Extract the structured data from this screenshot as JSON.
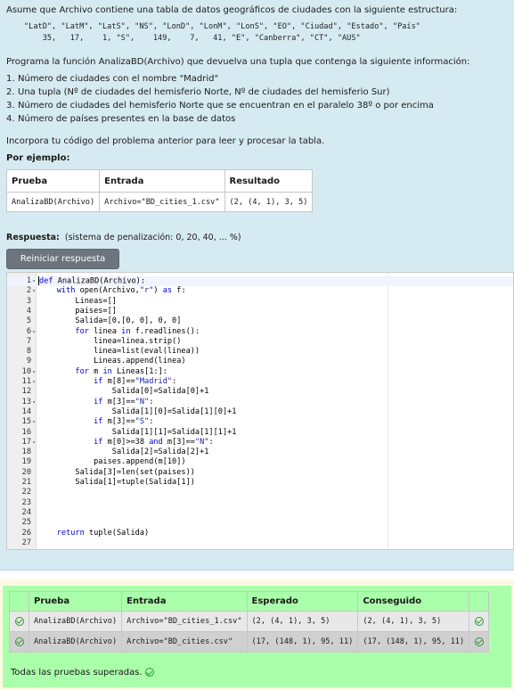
{
  "question": {
    "intro": "Asume que Archivo contiene una tabla de datos geográficos de ciudades con la siguiente estructura:",
    "structure_header": "\"LatD\", \"LatM\", \"LatS\", \"NS\", \"LonD\", \"LonM\", \"LonS\", \"EO\", \"Ciudad\", \"Estado\", \"País\"",
    "structure_row": "    35,   17,    1, \"S\",    149,    7,   41, \"E\", \"Canberra\", \"CT\", \"AUS\"",
    "prompt": "Programa la función AnalizaBD(Archivo) que devuelva una tupla que contenga la siguiente información:",
    "requirements": [
      {
        "num": "1.",
        "text": "Número de ciudades con el nombre \"Madrid\""
      },
      {
        "num": "2.",
        "text": "Una tupla (Nº de ciudades del hemisferio Norte, Nº de ciudades del hemisferio Sur)"
      },
      {
        "num": "3.",
        "text": "Número de ciudades del hemisferio Norte que se encuentran en el paralelo 38º o por encima"
      },
      {
        "num": "4.",
        "text": "Número de países presentes en la base de datos"
      }
    ],
    "incorporate": "Incorpora tu código del problema anterior para leer y procesar la tabla.",
    "example_label": "Por ejemplo:",
    "example_table": {
      "headers": [
        "Prueba",
        "Entrada",
        "Resultado"
      ],
      "rows": [
        [
          "AnalizaBD(Archivo)",
          "Archivo=\"BD_cities_1.csv\"",
          "(2, (4, 1), 3, 5)"
        ]
      ]
    }
  },
  "answer": {
    "label": "Respuesta:",
    "penalty": "(sistema de penalización: 0, 20, 40, ... %)",
    "reset_button": "Reiniciar respuesta"
  },
  "editor": {
    "lines": [
      {
        "n": "1",
        "fold": true,
        "code": "def AnalizaBD(Archivo):"
      },
      {
        "n": "2",
        "fold": true,
        "code": "    with open(Archivo,\"r\") as f:"
      },
      {
        "n": "3",
        "fold": false,
        "code": "        Lineas=[]"
      },
      {
        "n": "4",
        "fold": false,
        "code": "        paises=[]"
      },
      {
        "n": "5",
        "fold": false,
        "code": "        Salida=[0,[0, 0], 0, 0]"
      },
      {
        "n": "6",
        "fold": true,
        "code": "        for linea in f.readlines():"
      },
      {
        "n": "7",
        "fold": false,
        "code": "            linea=linea.strip()"
      },
      {
        "n": "8",
        "fold": false,
        "code": "            linea=list(eval(linea))"
      },
      {
        "n": "9",
        "fold": false,
        "code": "            Lineas.append(linea)"
      },
      {
        "n": "10",
        "fold": true,
        "code": "        for m in Lineas[1:]:"
      },
      {
        "n": "11",
        "fold": true,
        "code": "            if m[8]==\"Madrid\":"
      },
      {
        "n": "12",
        "fold": false,
        "code": "                Salida[0]=Salida[0]+1"
      },
      {
        "n": "13",
        "fold": true,
        "code": "            if m[3]==\"N\":"
      },
      {
        "n": "14",
        "fold": false,
        "code": "                Salida[1][0]=Salida[1][0]+1"
      },
      {
        "n": "15",
        "fold": true,
        "code": "            if m[3]==\"S\":"
      },
      {
        "n": "16",
        "fold": false,
        "code": "                Salida[1][1]=Salida[1][1]+1"
      },
      {
        "n": "17",
        "fold": true,
        "code": "            if m[0]>=38 and m[3]==\"N\":"
      },
      {
        "n": "18",
        "fold": false,
        "code": "                Salida[2]=Salida[2]+1"
      },
      {
        "n": "19",
        "fold": false,
        "code": "            paises.append(m[10])"
      },
      {
        "n": "20",
        "fold": false,
        "code": "        Salida[3]=len(set(paises))"
      },
      {
        "n": "21",
        "fold": false,
        "code": "        Salida[1]=tuple(Salida[1])"
      },
      {
        "n": "22",
        "fold": false,
        "code": ""
      },
      {
        "n": "23",
        "fold": false,
        "code": ""
      },
      {
        "n": "24",
        "fold": false,
        "code": ""
      },
      {
        "n": "25",
        "fold": false,
        "code": ""
      },
      {
        "n": "26",
        "fold": false,
        "code": "    return tuple(Salida)"
      },
      {
        "n": "27",
        "fold": false,
        "code": ""
      }
    ]
  },
  "results": {
    "headers": [
      "",
      "Prueba",
      "Entrada",
      "Esperado",
      "Conseguido",
      ""
    ],
    "rows": [
      {
        "test": "AnalizaBD(Archivo)",
        "input": "Archivo=\"BD_cities_1.csv\"",
        "expected": "(2, (4, 1), 3, 5)",
        "got": "(2, (4, 1), 3, 5)"
      },
      {
        "test": "AnalizaBD(Archivo)",
        "input": "Archivo=\"BD_cities.csv\"",
        "expected": "(17, (148, 1), 95, 11)",
        "got": "(17, (148, 1), 95, 11)"
      }
    ],
    "summary": "Todas las pruebas superadas."
  },
  "colors": {
    "question_bg": "#d6ebf1",
    "results_outer_bg": "#fcf8e3",
    "results_pass_bg": "#aaffaa",
    "button_bg": "#6c757d",
    "pass_icon": "#2a9d2a"
  }
}
